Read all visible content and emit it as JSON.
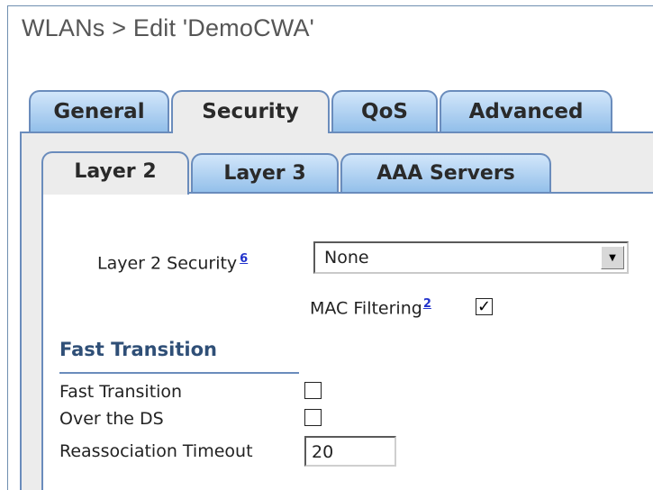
{
  "page": {
    "title": "WLANs > Edit  'DemoCWA'"
  },
  "tabs": [
    {
      "label": "General",
      "active": false
    },
    {
      "label": "Security",
      "active": true
    },
    {
      "label": "QoS",
      "active": false
    },
    {
      "label": "Advanced",
      "active": false
    }
  ],
  "subtabs": [
    {
      "label": "Layer 2",
      "active": true
    },
    {
      "label": "Layer 3",
      "active": false
    },
    {
      "label": "AAA Servers",
      "active": false
    }
  ],
  "layer2": {
    "security_label": "Layer 2 Security",
    "security_footnote": "6",
    "security_value": "None",
    "mac_filtering_label": "MAC Filtering",
    "mac_filtering_footnote": "2",
    "mac_filtering_checked": true
  },
  "fast_transition": {
    "heading": "Fast Transition",
    "fast_transition_label": "Fast Transition",
    "fast_transition_checked": false,
    "over_ds_label": "Over the DS",
    "over_ds_checked": false,
    "reassoc_label": "Reassociation Timeout",
    "reassoc_value": "20"
  },
  "colors": {
    "tab_blue": "#8fbde9",
    "tab_border": "#6a8cbc",
    "section_heading": "#2f4f77",
    "link": "#2233cc"
  }
}
